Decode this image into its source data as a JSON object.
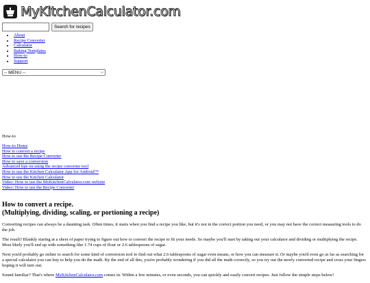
{
  "logo": {
    "text": "MyKitchenCalculator.com"
  },
  "search": {
    "placeholder": "",
    "value": "",
    "button_label": "Search for recipes"
  },
  "nav": {
    "items": [
      {
        "label": "About"
      },
      {
        "label": "Recipe Converter"
      },
      {
        "label": "Calculator"
      },
      {
        "label": "Baking Templates"
      },
      {
        "label": "How-to"
      },
      {
        "label": "Support"
      }
    ]
  },
  "menu": {
    "selected": "-- MENU --"
  },
  "howto": {
    "title": "How-to",
    "links": [
      {
        "label": "How-to Home"
      },
      {
        "label": "How to convert a recipe"
      },
      {
        "label": "How to use the Recipe Converter"
      },
      {
        "label": "How to save a conversion"
      },
      {
        "label": "Advanced tips on using the recipe converter tool"
      },
      {
        "label": "How to use the Kitchen Calculator App for Android™"
      },
      {
        "label": "How to use the Kitchen Calculator"
      },
      {
        "label": "Video: How to use the MyKitchenCalculator.com website"
      },
      {
        "label": "Video: How to use the Recipe Converter"
      }
    ]
  },
  "article": {
    "title_line1": "How to convert a recipe.",
    "title_line2": "(Multiplying, dividing, scaling, or portioning a recipe)",
    "p1": "Converting recipes can always be a daunting task. Often times, it starts when you find a recipe you like, but it's not in the correct portion you need, or you may not have the correct measuring tools to do the job.",
    "p2": "The result? Blankly staring at a sheet of paper trying to figure out how to convert the recipe to fit your needs. So maybe you'll start by taking out your calculator and dividing or multiplying the recipe. Most likely you'll end up with something like 1.74 cups of flour or 2.6 tablespoons of sugar.",
    "p3": "Next you'd probably go online to search for some kind of conversion tool to find out what 2.6 tablespoons of sugar even means, or how you can measure it. Or maybe you'd even go as far as searching for a special calculator you can buy to help you do the math. By the end of all this, you're probably wondering if you did all the math correctly, so you try out the newly converted recipe and cross your fingers hoping it will turn out.",
    "p4_before": "Sound familiar? That's where ",
    "p4_link": "MyKitchenCalculator.com",
    "p4_after": " comes in. Within a few minutes, or even seconds, you can quickly and easily convert recipes. Just follow the simple steps below!"
  }
}
